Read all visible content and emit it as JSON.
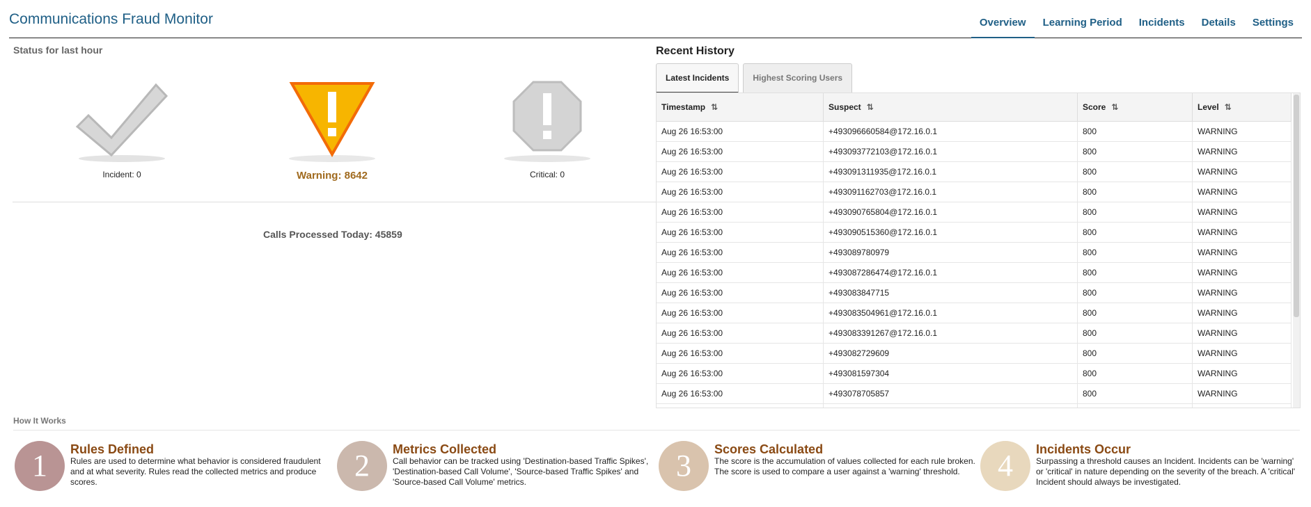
{
  "app": {
    "title": "Communications Fraud Monitor"
  },
  "nav": [
    {
      "label": "Overview",
      "active": true
    },
    {
      "label": "Learning Period",
      "active": false
    },
    {
      "label": "Incidents",
      "active": false
    },
    {
      "label": "Details",
      "active": false
    },
    {
      "label": "Settings",
      "active": false
    }
  ],
  "status": {
    "title": "Status for last hour",
    "incident": "Incident: 0",
    "warning": "Warning: 8642",
    "critical": "Critical: 0",
    "calls": "Calls Processed Today: 45859"
  },
  "history": {
    "title": "Recent History",
    "tabs": [
      {
        "label": "Latest Incidents",
        "active": true
      },
      {
        "label": "Highest Scoring Users",
        "active": false
      }
    ],
    "columns": [
      "Timestamp",
      "Suspect",
      "Score",
      "Level"
    ],
    "rows": [
      [
        "Aug 26 16:53:00",
        "+493096660584@172.16.0.1",
        "800",
        "WARNING"
      ],
      [
        "Aug 26 16:53:00",
        "+493093772103@172.16.0.1",
        "800",
        "WARNING"
      ],
      [
        "Aug 26 16:53:00",
        "+493091311935@172.16.0.1",
        "800",
        "WARNING"
      ],
      [
        "Aug 26 16:53:00",
        "+493091162703@172.16.0.1",
        "800",
        "WARNING"
      ],
      [
        "Aug 26 16:53:00",
        "+493090765804@172.16.0.1",
        "800",
        "WARNING"
      ],
      [
        "Aug 26 16:53:00",
        "+493090515360@172.16.0.1",
        "800",
        "WARNING"
      ],
      [
        "Aug 26 16:53:00",
        "+493089780979",
        "800",
        "WARNING"
      ],
      [
        "Aug 26 16:53:00",
        "+493087286474@172.16.0.1",
        "800",
        "WARNING"
      ],
      [
        "Aug 26 16:53:00",
        "+493083847715",
        "800",
        "WARNING"
      ],
      [
        "Aug 26 16:53:00",
        "+493083504961@172.16.0.1",
        "800",
        "WARNING"
      ],
      [
        "Aug 26 16:53:00",
        "+493083391267@172.16.0.1",
        "800",
        "WARNING"
      ],
      [
        "Aug 26 16:53:00",
        "+493082729609",
        "800",
        "WARNING"
      ],
      [
        "Aug 26 16:53:00",
        "+493081597304",
        "800",
        "WARNING"
      ],
      [
        "Aug 26 16:53:00",
        "+493078705857",
        "800",
        "WARNING"
      ],
      [
        "",
        "",
        "",
        ""
      ]
    ]
  },
  "how": {
    "title": "How It Works",
    "steps": [
      {
        "number": "1",
        "title": "Rules Defined",
        "text": "Rules are used to determine what behavior is considered fraudulent and at what severity. Rules read the collected metrics and produce scores.",
        "color": "#b99494"
      },
      {
        "number": "2",
        "title": "Metrics Collected",
        "text": "Call behavior can be tracked using 'Destination-based Traffic Spikes', 'Destination-based Call Volume', 'Source-based Traffic Spikes' and 'Source-based Call Volume' metrics.",
        "color": "#cbb8ad"
      },
      {
        "number": "3",
        "title": "Scores Calculated",
        "text": "The score is the accumulation of values collected for each rule broken. The score is used to compare a user against a 'warning' threshold.",
        "color": "#d9c3ad"
      },
      {
        "number": "4",
        "title": "Incidents Occur",
        "text": "Surpassing a threshold causes an Incident. Incidents can be 'warning' or 'critical' in nature depending on the severity of the breach. A 'critical' Incident should always be investigated.",
        "color": "#e8d8bd"
      }
    ]
  },
  "colors": {
    "brand": "#1f5f86",
    "warning": "#f5b400",
    "warning_text": "#a06a1e",
    "step_title": "#8a4a14"
  }
}
